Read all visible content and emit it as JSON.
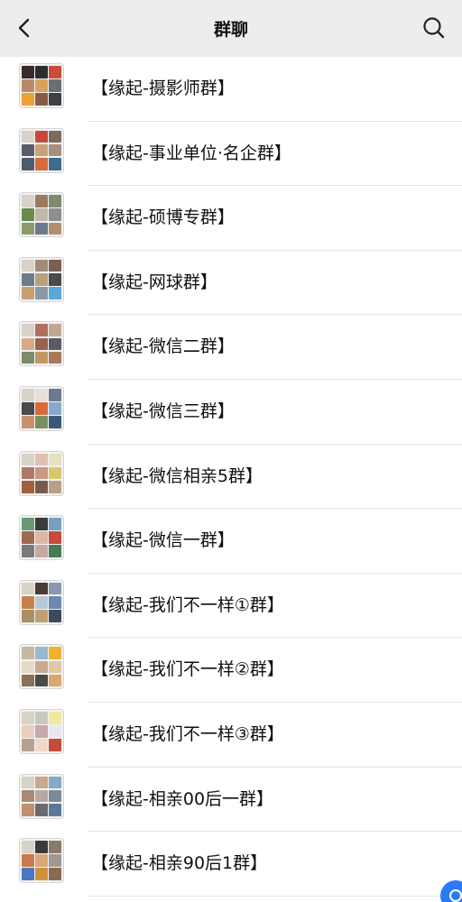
{
  "header": {
    "title": "群聊",
    "back_icon": "chevron-left-icon",
    "search_icon": "search-icon"
  },
  "groups": [
    {
      "name": "【缘起-摄影师群】",
      "avatar_colors": [
        "#3a2b2b",
        "#2d2d2d",
        "#c94d3a",
        "#b98a6a",
        "#d9a25a",
        "#6b6e75",
        "#f0a030",
        "#8a5a48",
        "#3f3f45"
      ]
    },
    {
      "name": "【缘起-事业单位·名企群】",
      "avatar_colors": [
        "#d9d2c8",
        "#c8473b",
        "#7a6b5c",
        "#5c5c68",
        "#c9a277",
        "#a89080",
        "#4a5d6e",
        "#d86a3a",
        "#3f6b8c"
      ]
    },
    {
      "name": "【缘起-硕博专群】",
      "avatar_colors": [
        "#d9d2c8",
        "#9a7a60",
        "#7f8a70",
        "#6a8a50",
        "#c0b8a8",
        "#8e8e8e",
        "#8a9a6a",
        "#6a7a8a",
        "#b09070"
      ]
    },
    {
      "name": "【缘起-网球群】",
      "avatar_colors": [
        "#d9d2c8",
        "#a08a78",
        "#7a6050",
        "#6c7a8a",
        "#b8a078",
        "#4a4a4a",
        "#c8a070",
        "#8a98a8",
        "#5aa8d8"
      ]
    },
    {
      "name": "【缘起-微信二群】",
      "avatar_colors": [
        "#d9d2c8",
        "#b07060",
        "#c0a890",
        "#d8a888",
        "#9a6050",
        "#5a5a60",
        "#7a8a6a",
        "#c09860",
        "#a87a58"
      ]
    },
    {
      "name": "【缘起-微信三群】",
      "avatar_colors": [
        "#d9d2c8",
        "#e8e0d8",
        "#6a7a90",
        "#4a4a4a",
        "#d86a3a",
        "#8aa8c8",
        "#c89070",
        "#7a9060",
        "#3a5a7a"
      ]
    },
    {
      "name": "【缘起-微信相亲5群】",
      "avatar_colors": [
        "#d9d2c8",
        "#e0c0b0",
        "#e8e0c0",
        "#b07868",
        "#c89880",
        "#d8c870",
        "#a0603a",
        "#7a5a4a",
        "#b8a080"
      ]
    },
    {
      "name": "【缘起-微信一群】",
      "avatar_colors": [
        "#6a9a70",
        "#3a3a3a",
        "#7aa0c0",
        "#a06a50",
        "#d8b8a8",
        "#c84a3a",
        "#7a7a7a",
        "#c8a8a0",
        "#4a7a50"
      ]
    },
    {
      "name": "【缘起-我们不一样①群】",
      "avatar_colors": [
        "#d9d2c8",
        "#4a3a3a",
        "#8a98b0",
        "#c8804a",
        "#b8c8d8",
        "#6a8ab0",
        "#a89060",
        "#c0a070",
        "#3a4a5a"
      ]
    },
    {
      "name": "【缘起-我们不一样②群】",
      "avatar_colors": [
        "#c8b8a0",
        "#9ab8d0",
        "#f0b030",
        "#e8d8c8",
        "#c8a890",
        "#e0c8a8",
        "#8a7058",
        "#4a4a4a",
        "#d8a870"
      ]
    },
    {
      "name": "【缘起-我们不一样③群】",
      "avatar_colors": [
        "#d9d2c8",
        "#c8c8c0",
        "#f0e8a0",
        "#e8d0c0",
        "#c8a8a8",
        "#e8e8f0",
        "#b8a090",
        "#f0d8c8",
        "#c84a3a"
      ]
    },
    {
      "name": "【缘起-相亲00后一群】",
      "avatar_colors": [
        "#d9d2c8",
        "#c8a890",
        "#8aa8c8",
        "#a88878",
        "#b8a8a0",
        "#7a8a9a",
        "#c09070",
        "#6a6a70",
        "#5a7a9a"
      ]
    },
    {
      "name": "【缘起-相亲90后1群】",
      "avatar_colors": [
        "#d9d2c8",
        "#3a3a3a",
        "#8a7a6a",
        "#c87a4a",
        "#d8a878",
        "#a09890",
        "#4a78c0",
        "#d0903a",
        "#8a6a50"
      ]
    }
  ],
  "fab_icon": "floating-assistant-icon"
}
